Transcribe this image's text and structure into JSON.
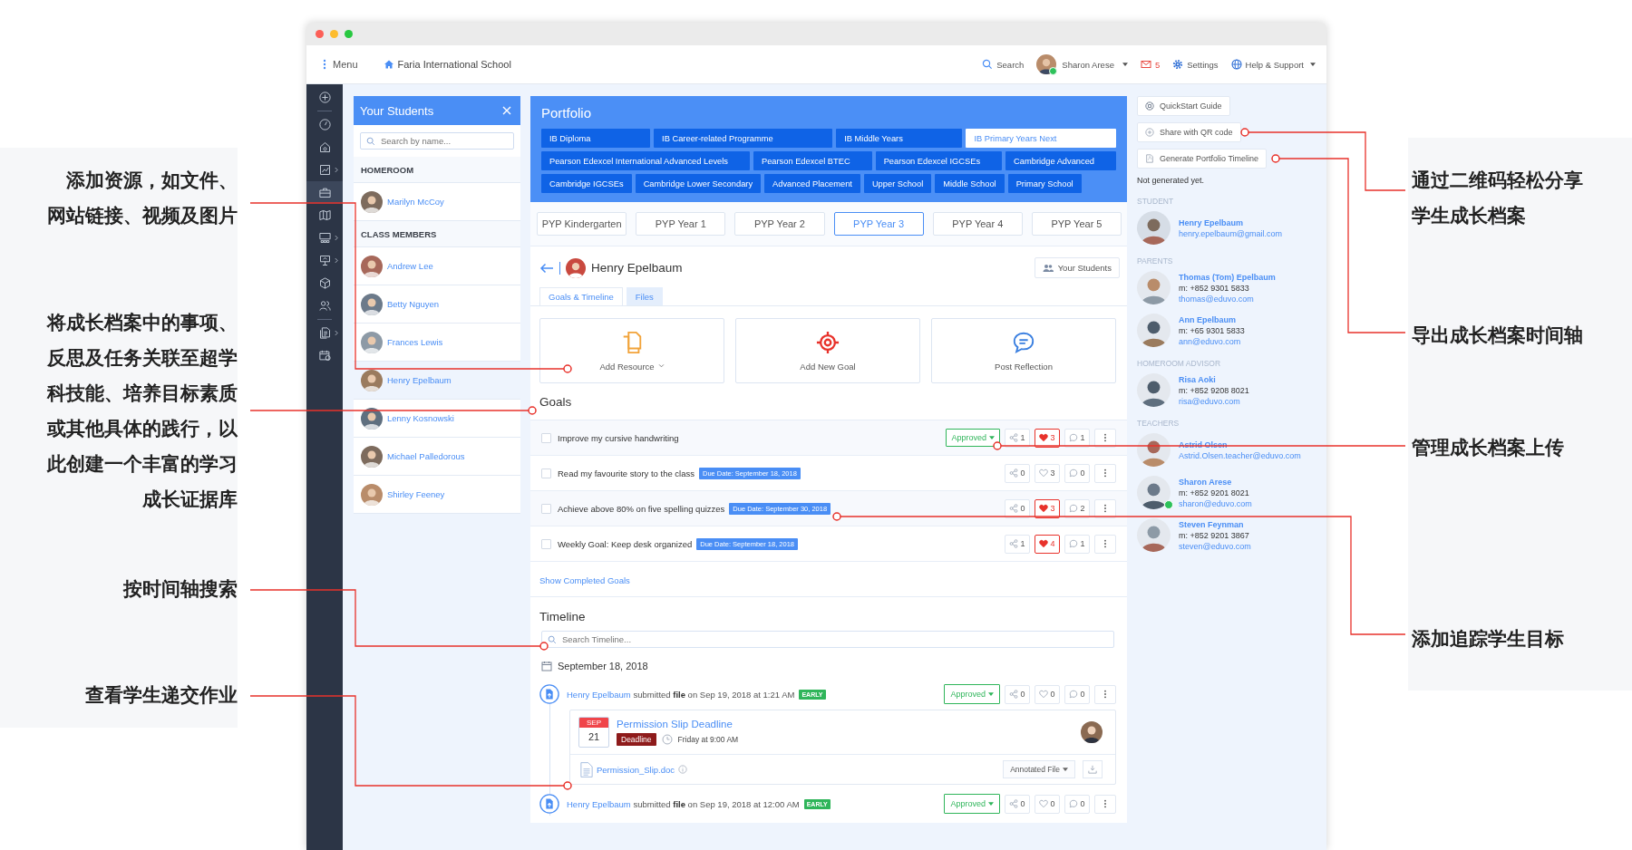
{
  "callouts": {
    "left": [
      {
        "lines": [
          "添加资源，如文件、",
          "网站链接、视频及图片"
        ]
      },
      {
        "lines": [
          "将成长档案中的事项、",
          "反思及任务关联至超学",
          "科技能、培养目标素质",
          "或其他具体的践行，以",
          "此创建一个丰富的学习",
          "成长证据库"
        ]
      },
      {
        "lines": [
          "按时间轴搜索"
        ]
      },
      {
        "lines": [
          "查看学生递交作业"
        ]
      }
    ],
    "right": [
      {
        "lines": [
          "通过二维码轻松分享",
          "学生成长档案"
        ]
      },
      {
        "lines": [
          "导出成长档案时间轴"
        ]
      },
      {
        "lines": [
          "管理成长档案上传"
        ]
      },
      {
        "lines": [
          "添加追踪学生目标"
        ]
      }
    ]
  },
  "header": {
    "menu": "Menu",
    "school": "Faria International School",
    "search": "Search",
    "user": "Sharon Arese",
    "user_online": true,
    "mail_count": "5",
    "settings": "Settings",
    "help": "Help & Support"
  },
  "sidebar": {
    "items": [
      {
        "selected": false,
        "submenu": false
      },
      {
        "selected": false,
        "submenu": false
      },
      {
        "selected": false,
        "submenu": false
      },
      {
        "selected": false,
        "submenu": true
      },
      {
        "selected": true,
        "submenu": false
      },
      {
        "selected": false,
        "submenu": false
      },
      {
        "selected": false,
        "submenu": true
      },
      {
        "selected": false,
        "submenu": true
      },
      {
        "selected": false,
        "submenu": false
      },
      {
        "selected": false,
        "submenu": false
      },
      {
        "selected": false,
        "submenu": true
      },
      {
        "selected": false,
        "submenu": false
      }
    ]
  },
  "students": {
    "title": "Your Students",
    "search_placeholder": "Search by name...",
    "groups": [
      {
        "label": "HOMEROOM",
        "students": [
          {
            "name": "Marilyn McCoy",
            "selected": false
          }
        ]
      },
      {
        "label": "CLASS MEMBERS",
        "students": [
          {
            "name": "Andrew Lee",
            "selected": false
          },
          {
            "name": "Betty Nguyen",
            "selected": false
          },
          {
            "name": "Frances Lewis",
            "selected": false
          },
          {
            "name": "Henry Epelbaum",
            "selected": true
          },
          {
            "name": "Lenny Kosnowski",
            "selected": false
          },
          {
            "name": "Michael Palledorous",
            "selected": false
          },
          {
            "name": "Shirley Feeney",
            "selected": false
          }
        ]
      }
    ]
  },
  "portfolio": {
    "title": "Portfolio",
    "program_rows": [
      [
        {
          "label": "IB Diploma",
          "selected": false
        },
        {
          "label": "IB Career-related Programme",
          "selected": false
        },
        {
          "label": "IB Middle Years",
          "selected": false
        },
        {
          "label": "IB Primary Years Next",
          "selected": true
        }
      ],
      [
        {
          "label": "Pearson Edexcel International Advanced Levels",
          "selected": false
        },
        {
          "label": "Pearson Edexcel BTEC",
          "selected": false
        },
        {
          "label": "Pearson Edexcel IGCSEs",
          "selected": false
        },
        {
          "label": "Cambridge Advanced",
          "selected": false
        }
      ],
      [
        {
          "label": "Cambridge IGCSEs",
          "selected": false
        },
        {
          "label": "Cambridge Lower Secondary",
          "selected": false
        },
        {
          "label": "Advanced Placement",
          "selected": false
        },
        {
          "label": "Upper School",
          "selected": false
        },
        {
          "label": "Middle School",
          "selected": false
        },
        {
          "label": "Primary School",
          "selected": false
        }
      ]
    ],
    "years": [
      {
        "label": "PYP Kindergarten",
        "selected": false
      },
      {
        "label": "PYP Year 1",
        "selected": false
      },
      {
        "label": "PYP Year 2",
        "selected": false
      },
      {
        "label": "PYP Year 3",
        "selected": true
      },
      {
        "label": "PYP Year 4",
        "selected": false
      },
      {
        "label": "PYP Year 5",
        "selected": false
      }
    ],
    "student_name": "Henry Epelbaum",
    "your_students_button": "Your Students",
    "tabs": [
      {
        "label": "Goals & Timeline",
        "selected": true
      },
      {
        "label": "Files",
        "selected": false
      }
    ],
    "actions": [
      {
        "kind": "resource",
        "label": "Add Resource",
        "dropdown": true
      },
      {
        "kind": "goal",
        "label": "Add New Goal",
        "dropdown": false
      },
      {
        "kind": "reflection",
        "label": "Post Reflection",
        "dropdown": false
      }
    ]
  },
  "goals": {
    "title": "Goals",
    "items": [
      {
        "text": "Improve my cursive handwriting",
        "checked": false,
        "status": "Approved",
        "shares": "1",
        "likes": "3",
        "liked": true,
        "comments": "1"
      },
      {
        "text": "Read my favourite story to the class",
        "checked": false,
        "due": "Due Date: September 18, 2018",
        "shares": "0",
        "likes": "3",
        "liked": false,
        "comments": "0"
      },
      {
        "text": "Achieve above 80% on five spelling quizzes",
        "checked": false,
        "due": "Due Date: September 30, 2018",
        "shares": "0",
        "likes": "3",
        "liked": true,
        "comments": "2"
      },
      {
        "text": "Weekly Goal: Keep desk organized",
        "checked": false,
        "due": "Due Date: September 18, 2018",
        "shares": "1",
        "likes": "4",
        "liked": true,
        "comments": "1"
      }
    ],
    "show_completed": "Show Completed Goals"
  },
  "timeline": {
    "title": "Timeline",
    "search_placeholder": "Search Timeline...",
    "date": "September 18, 2018",
    "entries": [
      {
        "author": "Henry Epelbaum",
        "action": "submitted **file** on Sep 19, 2018 at 1:21 AM",
        "badge": "EARLY",
        "status": "Approved",
        "shares": "0",
        "likes": "0",
        "liked": false,
        "comments": "0",
        "event": {
          "month": "SEP",
          "day": "21",
          "title": "Permission Slip Deadline",
          "tag": "Deadline",
          "time": "Friday at 9:00 AM",
          "file": "Permission_Slip.doc",
          "file_button": "Annotated File"
        }
      },
      {
        "author": "Henry Epelbaum",
        "action": "submitted **file** on Sep 19, 2018 at 12:00 AM",
        "badge": "EARLY",
        "status": "Approved",
        "shares": "0",
        "likes": "0",
        "liked": false,
        "comments": "0"
      }
    ]
  },
  "side": {
    "buttons": [
      {
        "kind": "guide",
        "label": "QuickStart Guide"
      },
      {
        "kind": "qr",
        "label": "Share with QR code"
      },
      {
        "kind": "pdf",
        "label": "Generate Portfolio Timeline"
      }
    ],
    "status": "Not generated yet.",
    "groups": [
      {
        "label": "STUDENT",
        "people": [
          {
            "name": "Henry Epelbaum",
            "email": "henry.epelbaum@gmail.com",
            "online": false
          }
        ]
      },
      {
        "label": "PARENTS",
        "people": [
          {
            "name": "Thomas (Tom) Epelbaum",
            "phone": "m: +852 9301 5833",
            "email": "thomas@eduvo.com",
            "online": false
          },
          {
            "name": "Ann Epelbaum",
            "phone": "m: +65 9301 5833",
            "email": "ann@eduvo.com",
            "online": false
          }
        ]
      },
      {
        "label": "HOMEROOM ADVISOR",
        "people": [
          {
            "name": "Risa Aoki",
            "phone": "m: +852 9208 8021",
            "email": "risa@eduvo.com",
            "online": false
          }
        ]
      },
      {
        "label": "TEACHERS",
        "people": [
          {
            "name": "Astrid Olsen",
            "email": "Astrid.Olsen.teacher@eduvo.com",
            "online": false
          },
          {
            "name": "Sharon Arese",
            "phone": "m: +852 9201 8021",
            "email": "sharon@eduvo.com",
            "online": true
          },
          {
            "name": "Steven Feynman",
            "phone": "m: +852 9201 3867",
            "email": "steven@eduvo.com",
            "online": false
          }
        ]
      }
    ]
  }
}
